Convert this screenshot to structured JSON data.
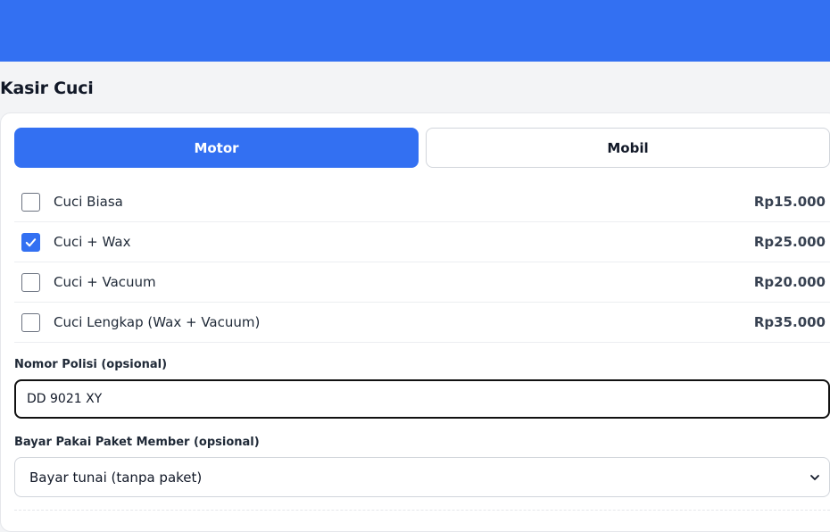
{
  "header": {
    "title": "Kasir Cuci"
  },
  "tabs": [
    {
      "label": "Motor",
      "active": true
    },
    {
      "label": "Mobil",
      "active": false
    }
  ],
  "services": [
    {
      "name": "Cuci Biasa",
      "price": "Rp15.000",
      "checked": false
    },
    {
      "name": "Cuci + Wax",
      "price": "Rp25.000",
      "checked": true
    },
    {
      "name": "Cuci + Vacuum",
      "price": "Rp20.000",
      "checked": false
    },
    {
      "name": "Cuci Lengkap (Wax + Vacuum)",
      "price": "Rp35.000",
      "checked": false
    }
  ],
  "plate": {
    "label": "Nomor Polisi (opsional)",
    "value": "DD 9021 XY"
  },
  "package": {
    "label": "Bayar Pakai Paket Member (opsional)",
    "selected": "Bayar tunai (tanpa paket)"
  },
  "colors": {
    "accent": "#3370f2",
    "background": "#f3f4f6"
  },
  "icons": {
    "check": "check-icon",
    "select_arrow": "chevron-down-icon"
  }
}
